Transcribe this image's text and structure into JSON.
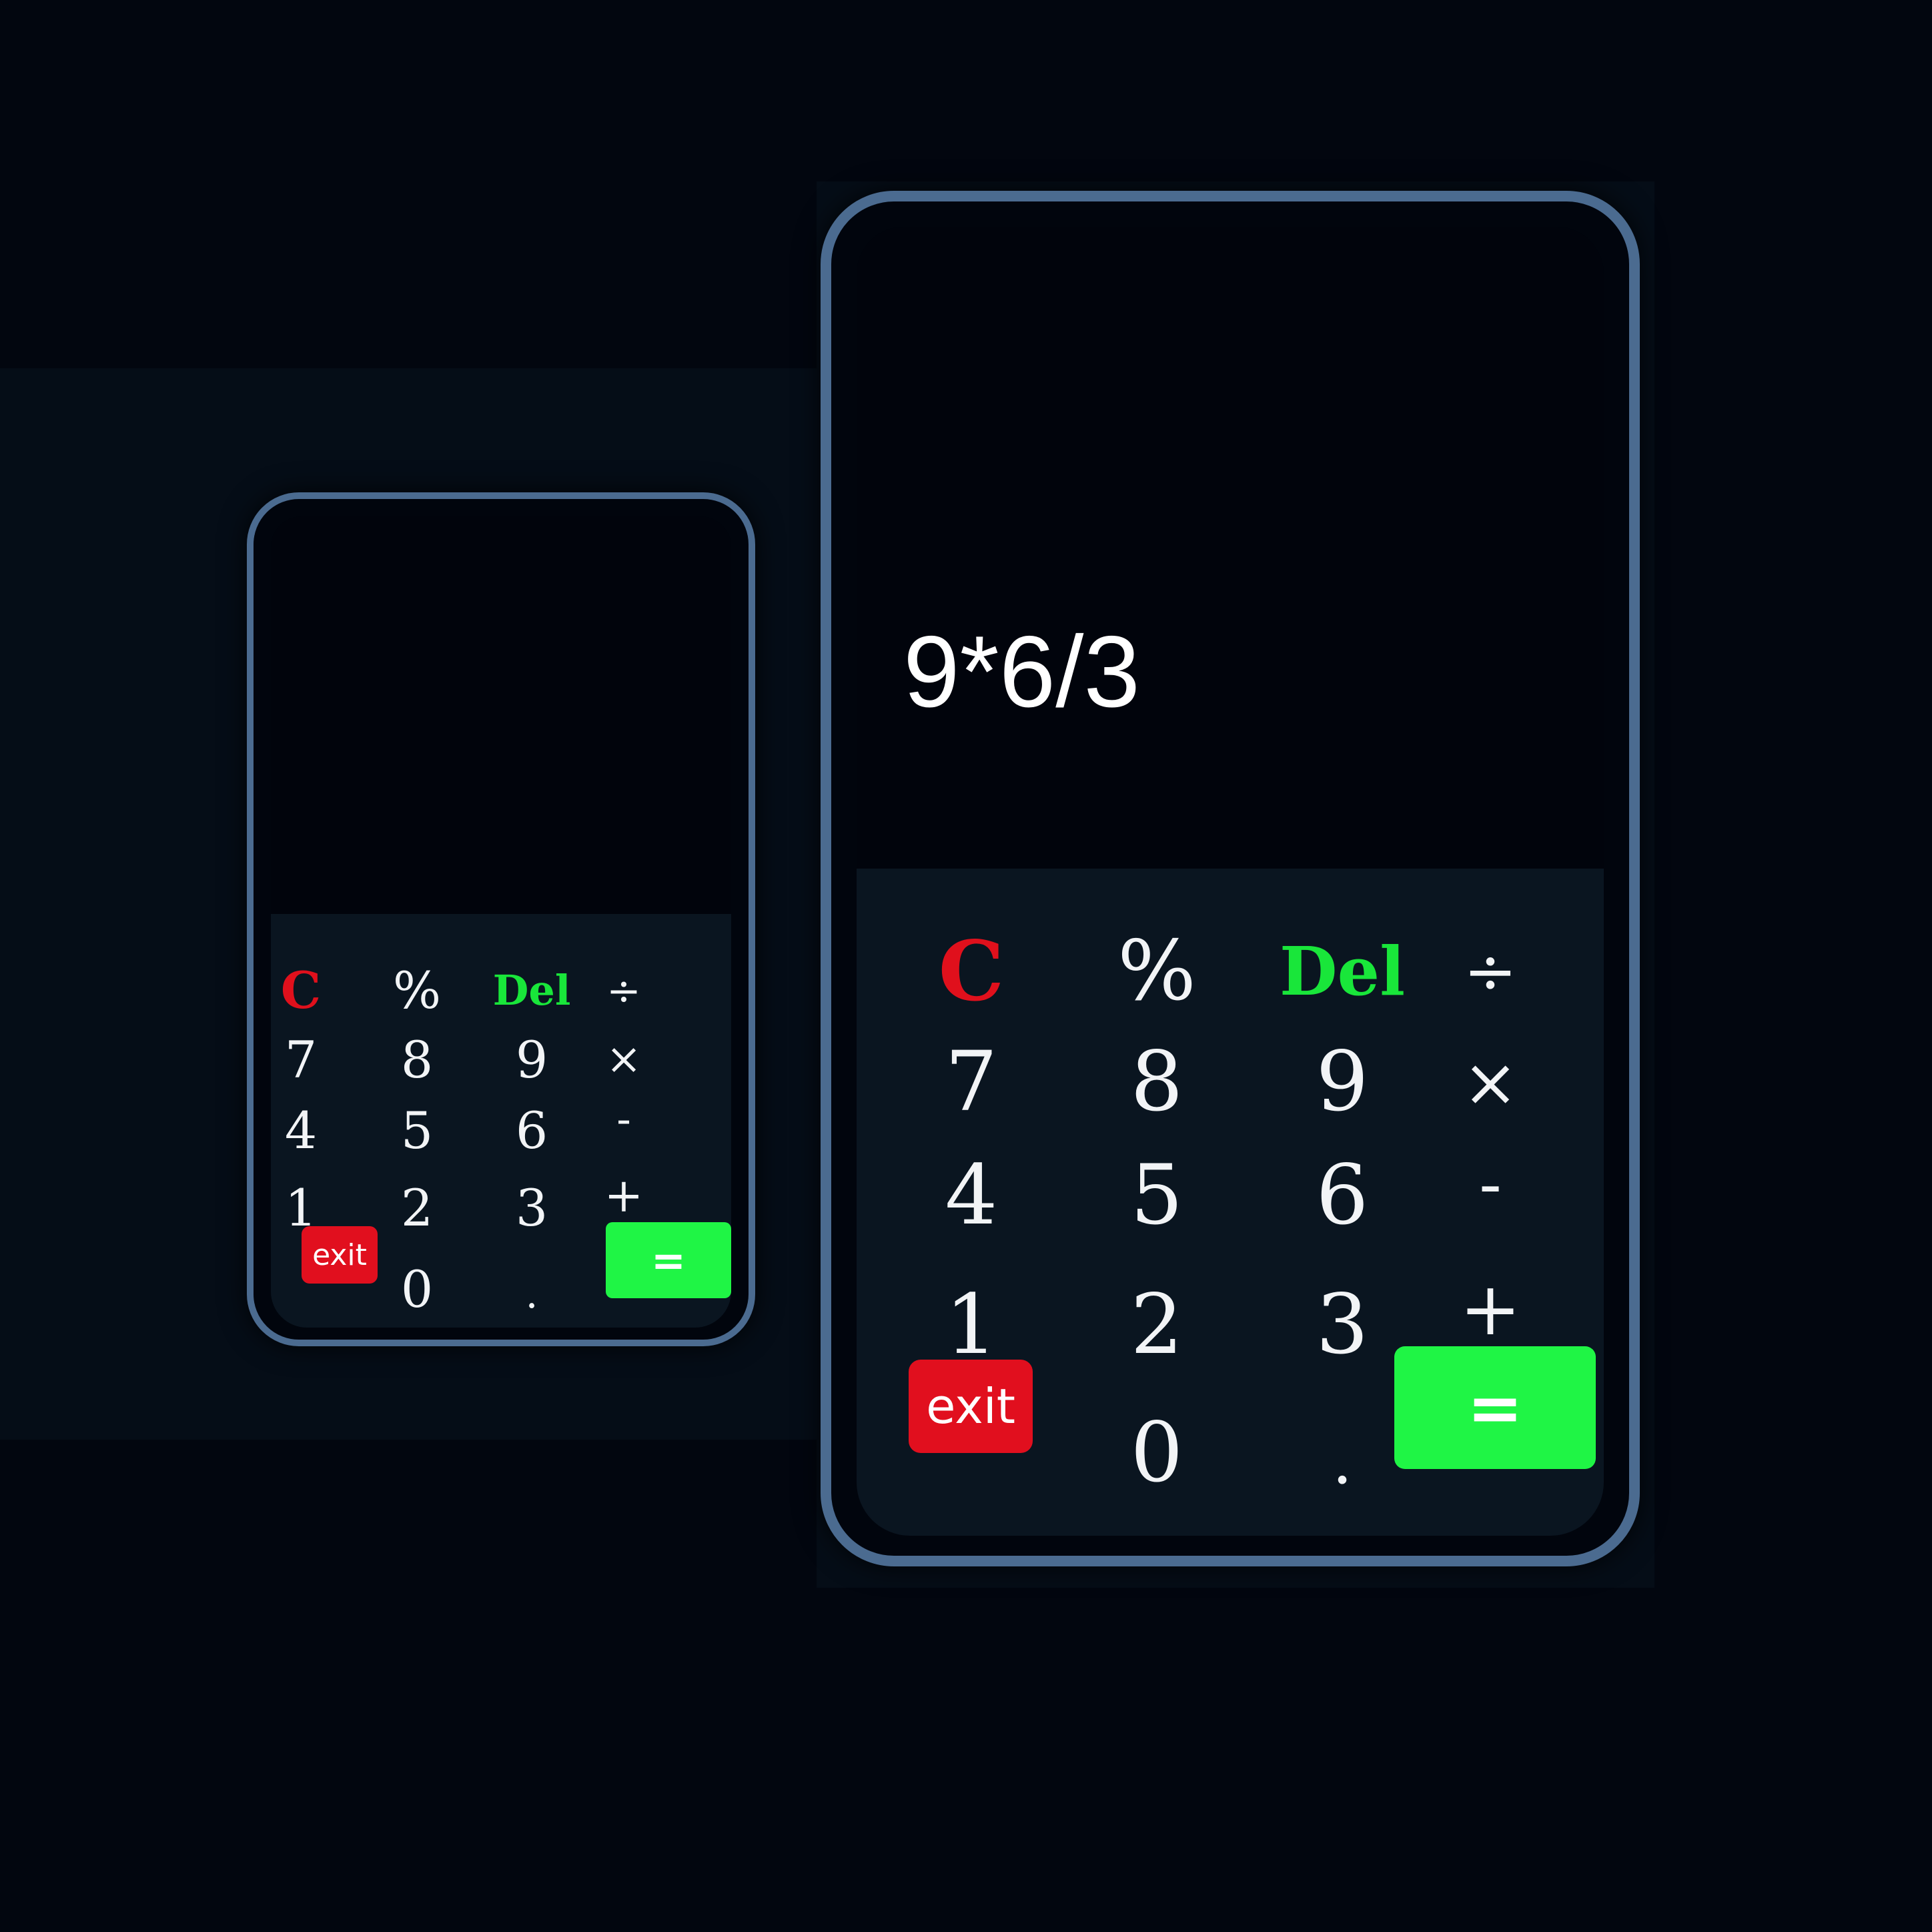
{
  "colors": {
    "page_background": "#02060f",
    "phone_border": "#4b6b90",
    "clear_key": "#e0101c",
    "delete_key": "#19e63a",
    "exit_button": "#e10f1e",
    "equals_button": "#1ff545"
  },
  "calculators": [
    {
      "display": "",
      "keys": {
        "clear": "C",
        "percent": "%",
        "delete": "Del",
        "divide": "÷",
        "seven": "7",
        "eight": "8",
        "nine": "9",
        "multiply": "×",
        "four": "4",
        "five": "5",
        "six": "6",
        "minus": "-",
        "one": "1",
        "two": "2",
        "three": "3",
        "plus": "+",
        "exit": "exit",
        "zero": "0",
        "dot": ".",
        "equals": "="
      }
    },
    {
      "display": "9*6/3",
      "keys": {
        "clear": "C",
        "percent": "%",
        "delete": "Del",
        "divide": "÷",
        "seven": "7",
        "eight": "8",
        "nine": "9",
        "multiply": "×",
        "four": "4",
        "five": "5",
        "six": "6",
        "minus": "-",
        "one": "1",
        "two": "2",
        "three": "3",
        "plus": "+",
        "exit": "exit",
        "zero": "0",
        "dot": ".",
        "equals": "="
      }
    }
  ]
}
